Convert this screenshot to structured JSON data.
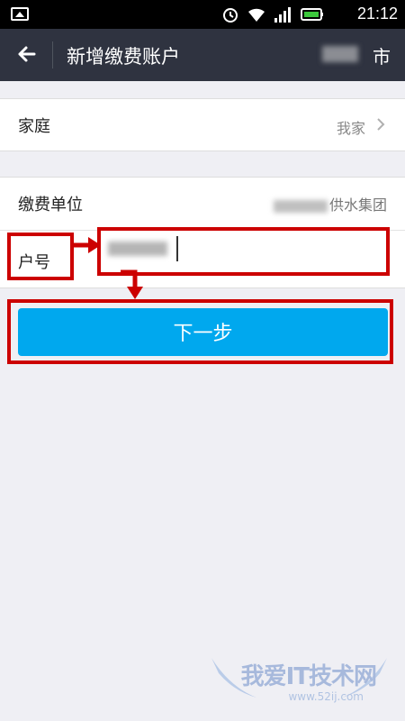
{
  "status_bar": {
    "time": "21:12"
  },
  "header": {
    "title": "新增缴费账户",
    "city_suffix": "市"
  },
  "family_row": {
    "label": "家庭",
    "value": "我家"
  },
  "org_row": {
    "label": "缴费单位",
    "value_suffix": "供水集团"
  },
  "account_row": {
    "label": "户号"
  },
  "next_button": {
    "label": "下一步"
  },
  "watermark": {
    "text": "我爱IT技术网",
    "url": "www.52ij.com"
  },
  "colors": {
    "accent": "#00a8ee",
    "header_bg": "#2f3340",
    "annotation_red": "#cc0000"
  }
}
